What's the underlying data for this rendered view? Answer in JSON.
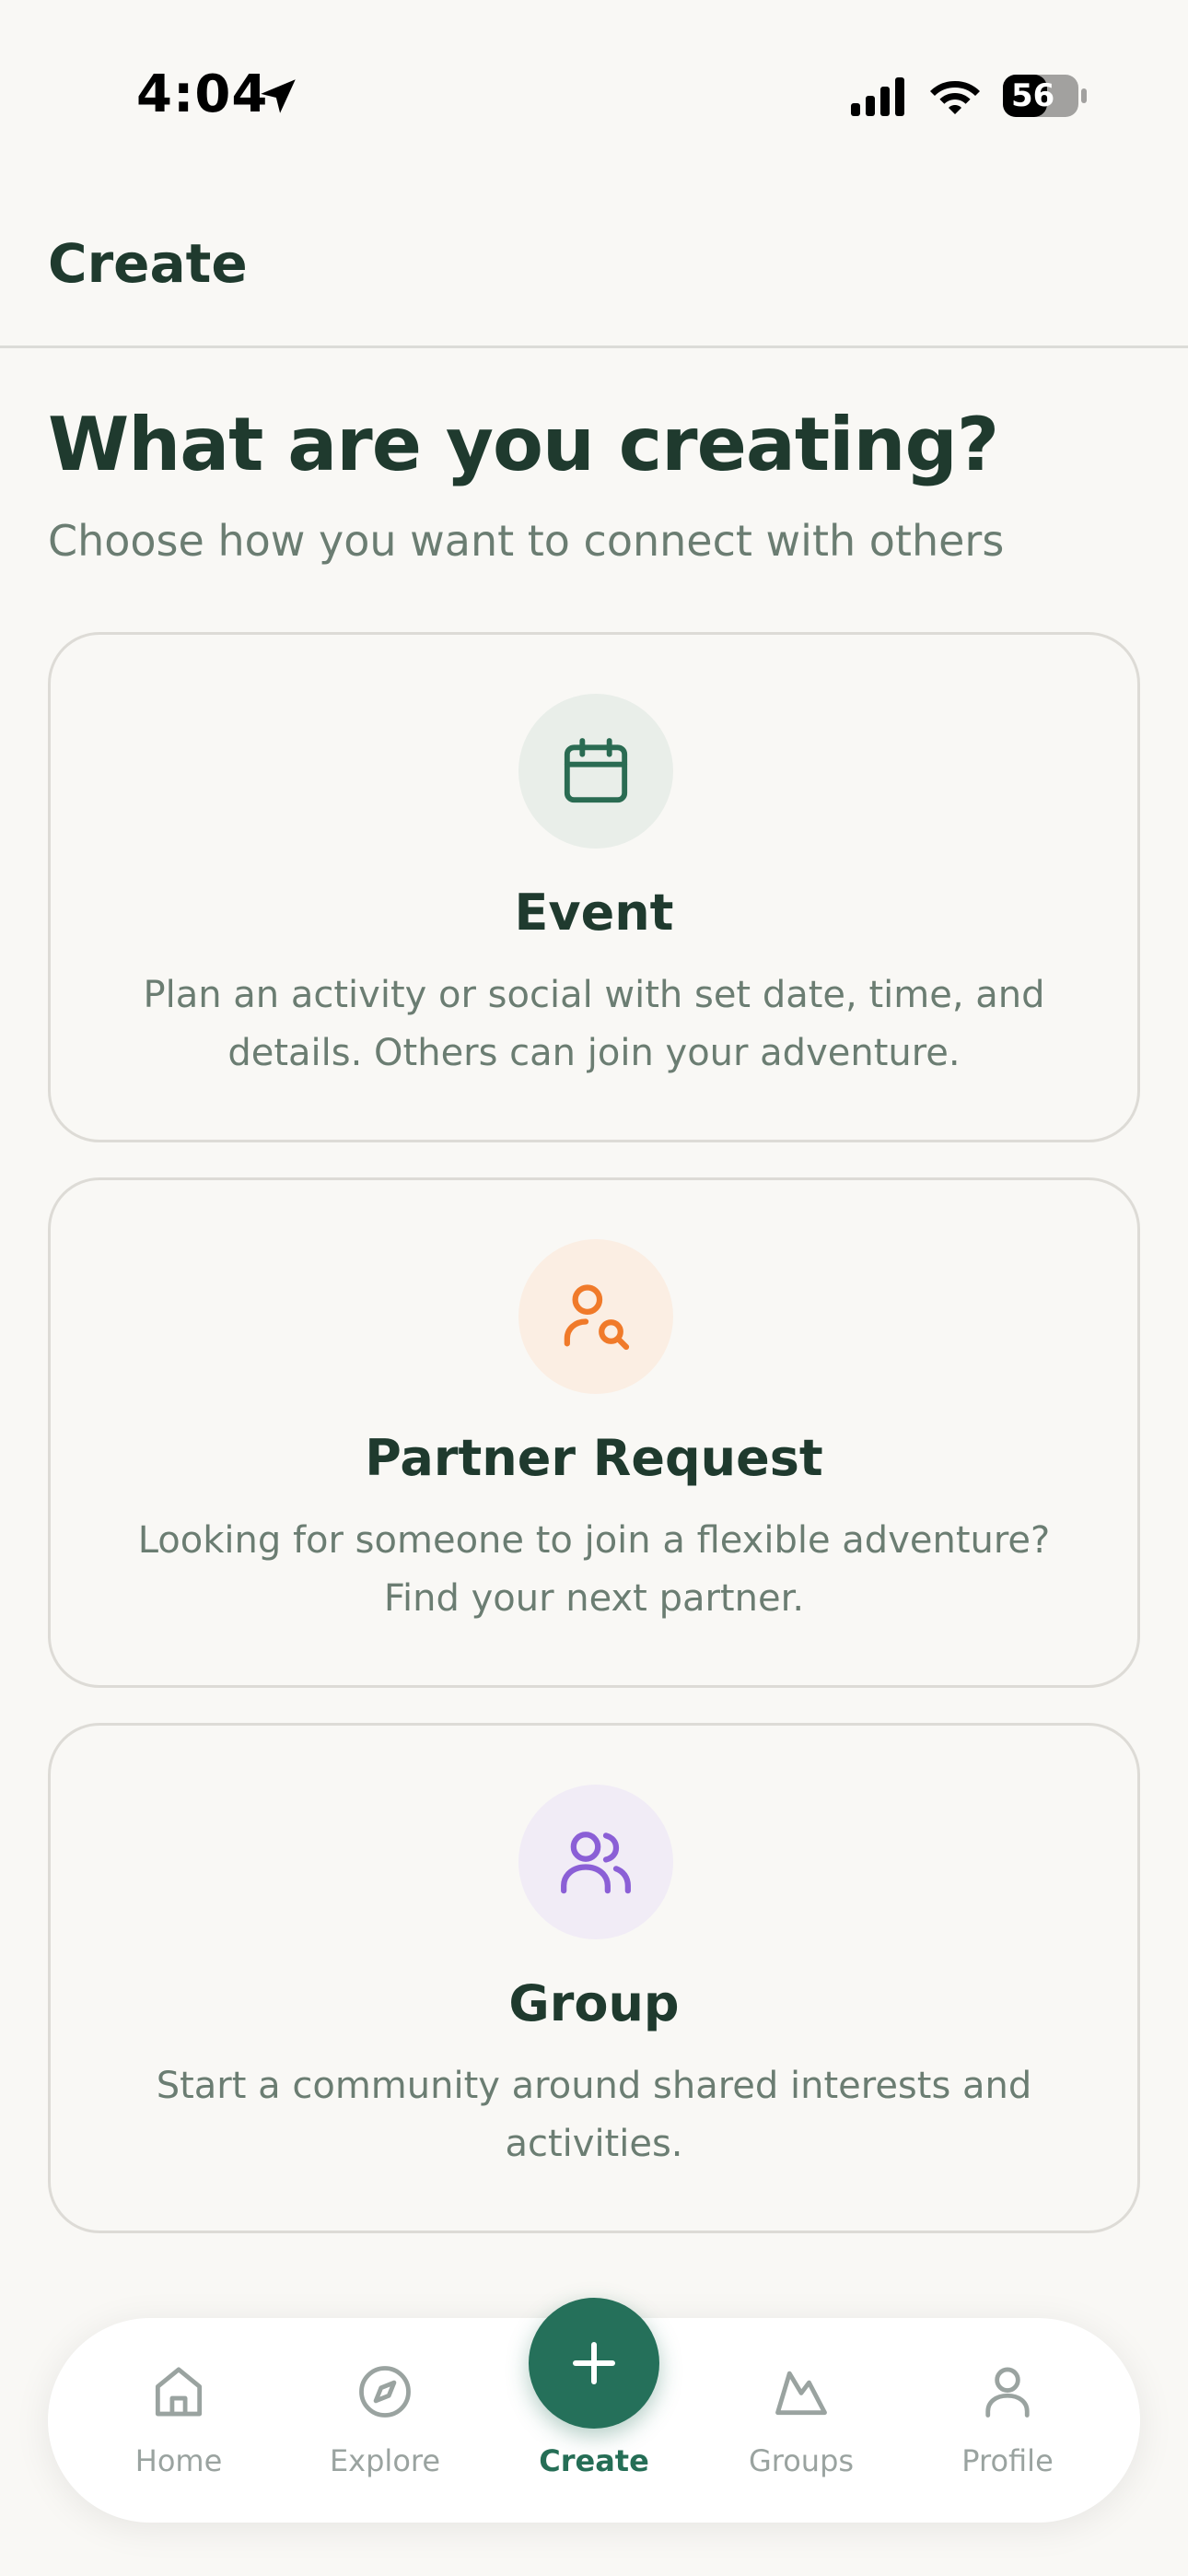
{
  "status_bar": {
    "time": "4:04",
    "battery_level": "56",
    "icons": [
      "location-arrow-icon",
      "cellular-signal-icon",
      "wifi-icon",
      "battery-icon"
    ]
  },
  "header": {
    "title": "Create"
  },
  "intro": {
    "heading": "What are you creating?",
    "subtitle": "Choose how you want to connect with others"
  },
  "options": [
    {
      "title": "Event",
      "description": "Plan an activity or social with set date, time, and details. Others can join your adventure.",
      "icon": "calendar-icon",
      "accent": "#2a6b52",
      "icon_bg": "#e9eee9"
    },
    {
      "title": "Partner Request",
      "description": "Looking for someone to join a flexible adventure? Find your next partner.",
      "icon": "user-search-icon",
      "accent": "#f07a2a",
      "icon_bg": "#fbeee3"
    },
    {
      "title": "Group",
      "description": "Start a community around shared interests and activities.",
      "icon": "users-icon",
      "accent": "#8b5fd6",
      "icon_bg": "#f1ecf6"
    }
  ],
  "bottom_nav": {
    "items": [
      {
        "label": "Home",
        "icon": "home-icon"
      },
      {
        "label": "Explore",
        "icon": "compass-icon"
      },
      {
        "label": "Create",
        "icon": "plus-icon",
        "active": true
      },
      {
        "label": "Groups",
        "icon": "mountain-icon"
      },
      {
        "label": "Profile",
        "icon": "user-icon"
      }
    ],
    "active_color": "#256e56",
    "inactive_color": "#9aa3a0"
  }
}
